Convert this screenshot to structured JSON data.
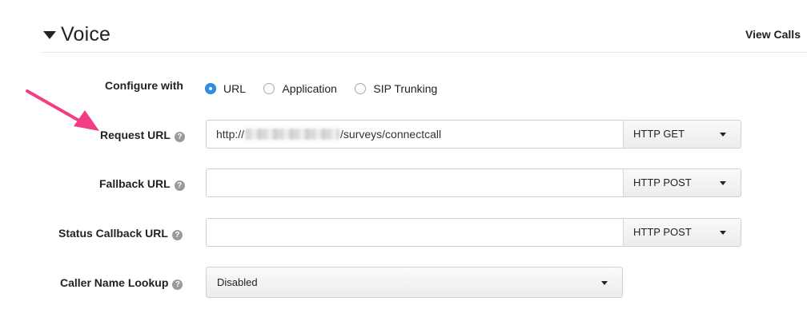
{
  "header": {
    "title": "Voice",
    "view_calls": "View Calls"
  },
  "configure": {
    "label": "Configure with",
    "options": [
      {
        "label": "URL",
        "selected": true
      },
      {
        "label": "Application",
        "selected": false
      },
      {
        "label": "SIP Trunking",
        "selected": false
      }
    ]
  },
  "fields": {
    "request_url": {
      "label": "Request URL",
      "value_prefix": "http://",
      "value_suffix": "/surveys/connectcall",
      "method": "HTTP GET"
    },
    "fallback_url": {
      "label": "Fallback URL",
      "value": "",
      "method": "HTTP POST"
    },
    "status_callback_url": {
      "label": "Status Callback URL",
      "value": "",
      "method": "HTTP POST"
    },
    "caller_name_lookup": {
      "label": "Caller Name Lookup",
      "value": "Disabled"
    }
  },
  "help_glyph": "?",
  "colors": {
    "arrow": "#f23d85",
    "radio_selected": "#2f8fe8",
    "help_icon": "#9a9a9a"
  },
  "icons": {
    "section_toggle": "caret-down-icon",
    "help": "question-circle-icon",
    "select": "chevron-down-icon"
  }
}
